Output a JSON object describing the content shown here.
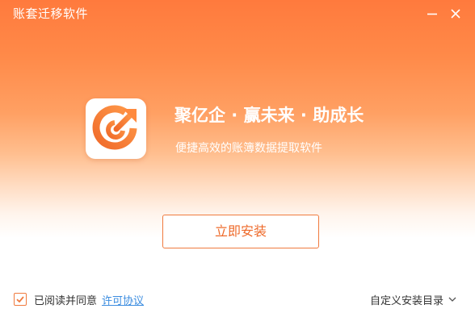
{
  "window": {
    "title": "账套迁移软件"
  },
  "hero": {
    "slogan": "聚亿企 · 赢未来 · 助成长",
    "subtitle": "便捷高效的账簿数据提取软件"
  },
  "actions": {
    "install_label": "立即安装"
  },
  "footer": {
    "agree_text": "已阅读并同意",
    "agree_checked": true,
    "license_link": "许可协议",
    "custom_dir_label": "自定义安装目录"
  },
  "icons": {
    "minimize": "minimize-icon",
    "close": "close-icon",
    "logo": "app-logo",
    "checkbox": "checkmark-icon",
    "dropdown": "chevron-down-icon"
  },
  "colors": {
    "accent": "#ff7a3d",
    "button_text": "#ee6a2a",
    "link": "#3c8de0"
  }
}
